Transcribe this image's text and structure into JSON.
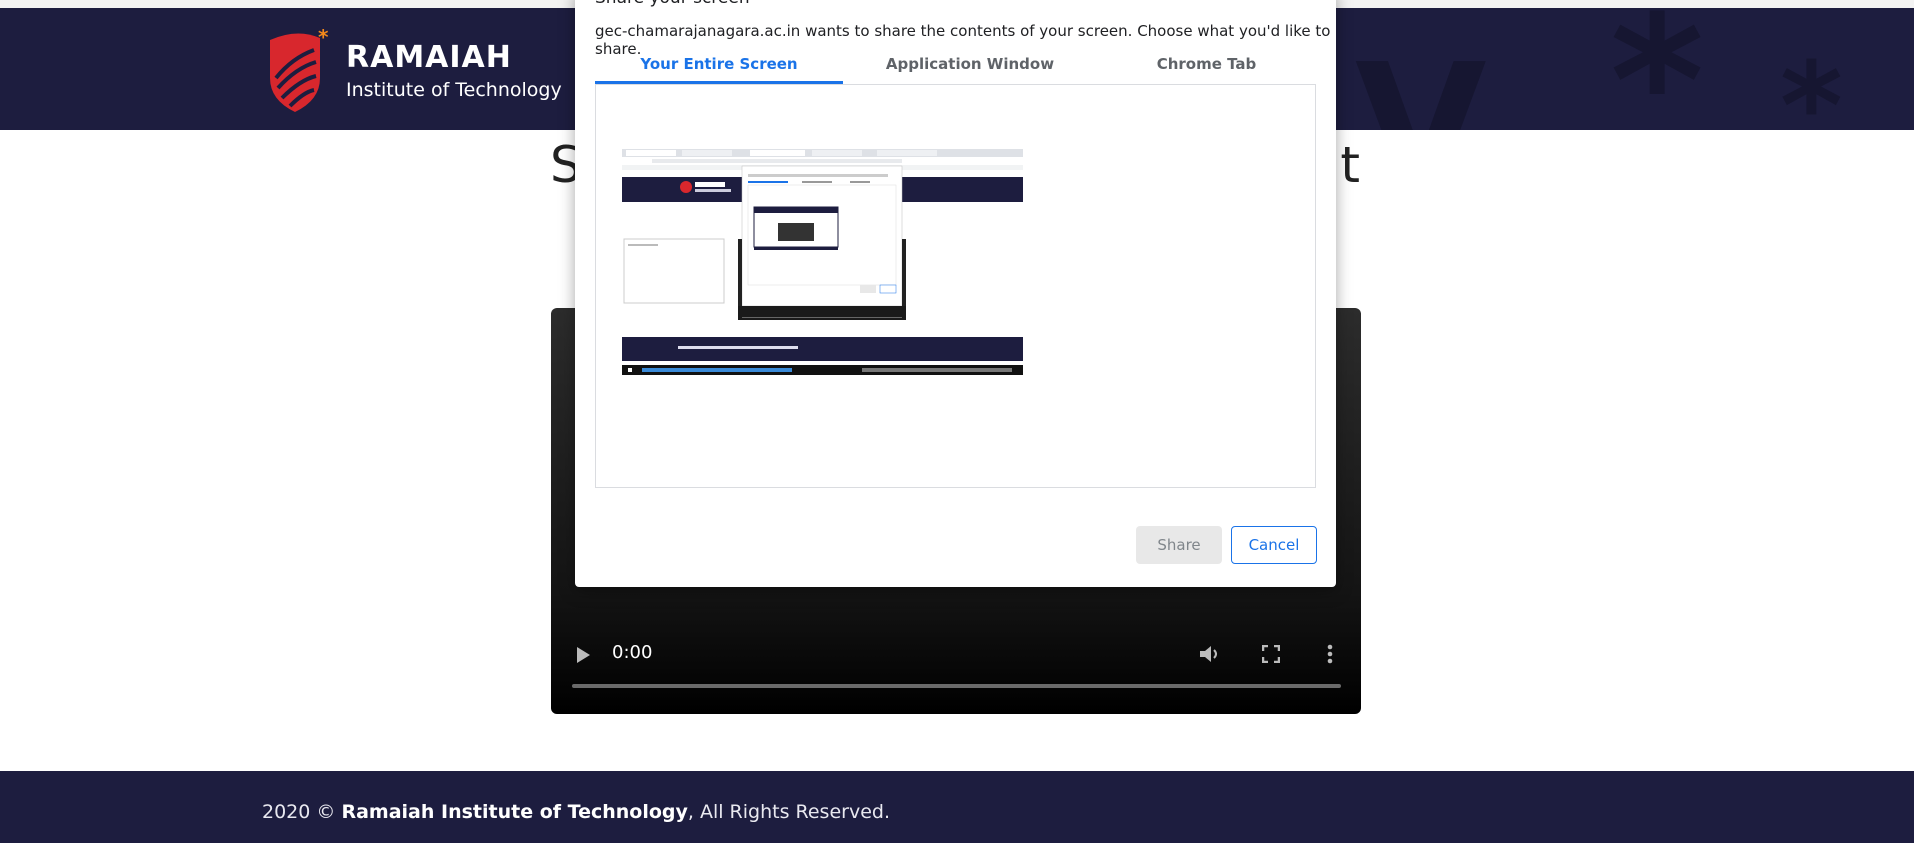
{
  "header": {
    "logo_title": "RAMAIAH",
    "logo_subtitle": "Institute of Technology"
  },
  "page": {
    "title_left": "S",
    "title_right": "t"
  },
  "video": {
    "time": "0:00",
    "icons": [
      "play-icon",
      "volume-icon",
      "fullscreen-icon",
      "more-options-icon"
    ]
  },
  "footer": {
    "year": "2020 ©",
    "org": "Ramaiah Institute of Technology",
    "rights": ", All Rights Reserved."
  },
  "dialog": {
    "title": "Share your screen",
    "description": "gec-chamarajanagara.ac.in wants to share the contents of your screen. Choose what you'd like to share.",
    "tabs": [
      {
        "label": "Your Entire Screen",
        "active": true
      },
      {
        "label": "Application Window",
        "active": false
      },
      {
        "label": "Chrome Tab",
        "active": false
      }
    ],
    "share_label": "Share",
    "cancel_label": "Cancel"
  },
  "colors": {
    "brand_navy": "#1d1d3f",
    "accent_blue": "#1a73e8",
    "logo_red": "#e0322c"
  }
}
